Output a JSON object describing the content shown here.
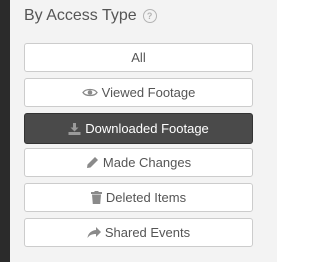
{
  "filter": {
    "title": "By Access Type",
    "help_icon": "question-circle-icon",
    "options": [
      {
        "label": "All",
        "icon": ""
      },
      {
        "label": "Viewed Footage",
        "icon": "eye-icon"
      },
      {
        "label": "Downloaded Footage",
        "icon": "download-icon",
        "selected": true
      },
      {
        "label": "Made Changes",
        "icon": "pencil-icon"
      },
      {
        "label": "Deleted Items",
        "icon": "trash-icon"
      },
      {
        "label": "Shared Events",
        "icon": "share-icon"
      }
    ]
  },
  "colors": {
    "selected_bg": "#4a4a4a",
    "button_bg": "#ffffff",
    "panel_bg": "#f3f3f3",
    "text": "#555555"
  }
}
